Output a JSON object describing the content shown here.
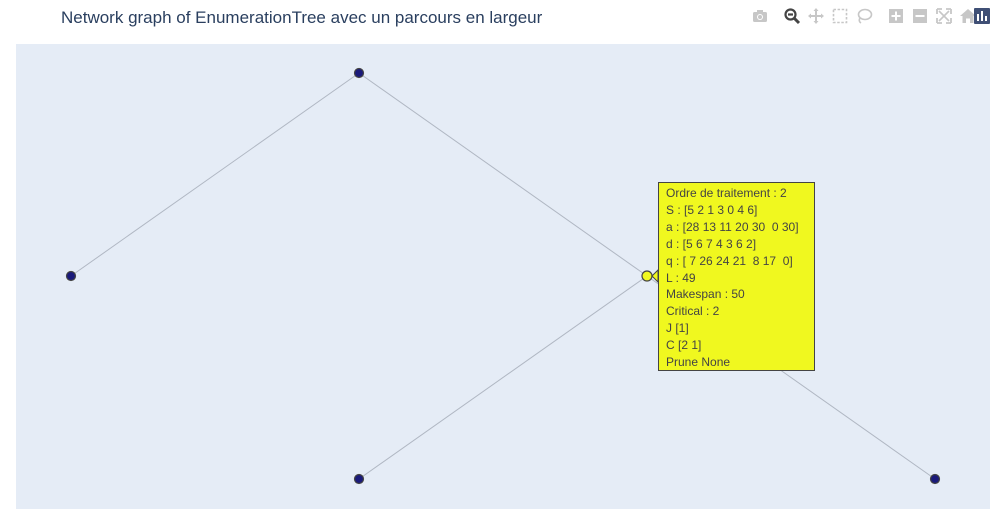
{
  "title": "Network graph of EnumerationTree avec un parcours en largeur",
  "modebar": [
    {
      "name": "camera-icon"
    },
    {
      "name": "zoom-icon",
      "active": true
    },
    {
      "name": "pan-icon"
    },
    {
      "name": "box-select-icon"
    },
    {
      "name": "lasso-select-icon"
    },
    {
      "name": "zoom-in-icon"
    },
    {
      "name": "zoom-out-icon"
    },
    {
      "name": "autoscale-icon"
    },
    {
      "name": "reset-axes-icon"
    },
    {
      "name": "plotly-logo-icon"
    }
  ],
  "colors": {
    "plot_bg": "#e5ecf6",
    "edge": "#b0b7c3",
    "node": "#1a1a7a",
    "node_highlight": "#f0f81f",
    "hover_bg": "#f0f81f"
  },
  "hover": {
    "lines": [
      "Ordre de traitement : 2",
      "S : [5 2 1 3 0 4 6]",
      "a : [28 13 11 20 30  0 30]",
      "d : [5 6 7 4 3 6 2]",
      "q : [ 7 26 24 21  8 17  0]",
      "L : 49",
      "Makespan : 50",
      "Critical : 2",
      "J [1]",
      "C [2 1]",
      "Prune None"
    ]
  }
}
